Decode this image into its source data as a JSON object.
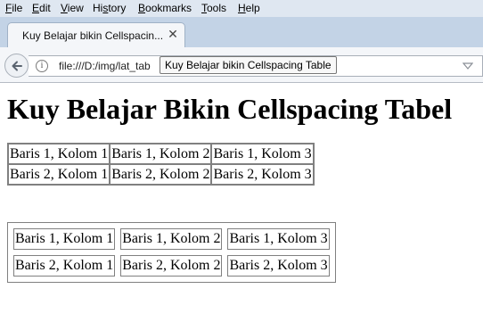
{
  "menubar": {
    "items": [
      {
        "pre": "",
        "u": "F",
        "post": "ile"
      },
      {
        "pre": "",
        "u": "E",
        "post": "dit"
      },
      {
        "pre": "",
        "u": "V",
        "post": "iew"
      },
      {
        "pre": "Hi",
        "u": "s",
        "post": "tory"
      },
      {
        "pre": "",
        "u": "B",
        "post": "ookmarks"
      },
      {
        "pre": "",
        "u": "T",
        "post": "ools"
      },
      {
        "pre": "",
        "u": "H",
        "post": "elp"
      }
    ]
  },
  "tab": {
    "title": "Kuy Belajar bikin Cellspacin...",
    "close_glyph": "✕"
  },
  "navbar": {
    "url": "file:///D:/img/lat_tab",
    "info_glyph": "i"
  },
  "tooltip": {
    "text": "Kuy Belajar bikin Cellspacing Table"
  },
  "page": {
    "heading": "Kuy Belajar Bikin Cellspacing Tabel",
    "table1": {
      "rows": [
        [
          "Baris 1, Kolom 1",
          "Baris 1, Kolom 2",
          "Baris 1, Kolom 3"
        ],
        [
          "Baris 2, Kolom 1",
          "Baris 2, Kolom 2",
          "Baris 2, Kolom 3"
        ]
      ]
    },
    "table2": {
      "rows": [
        [
          "Baris 1, Kolom 1",
          "Baris 1, Kolom 2",
          "Baris 1, Kolom 3"
        ],
        [
          "Baris 2, Kolom 1",
          "Baris 2, Kolom 2",
          "Baris 2, Kolom 3"
        ]
      ]
    }
  }
}
